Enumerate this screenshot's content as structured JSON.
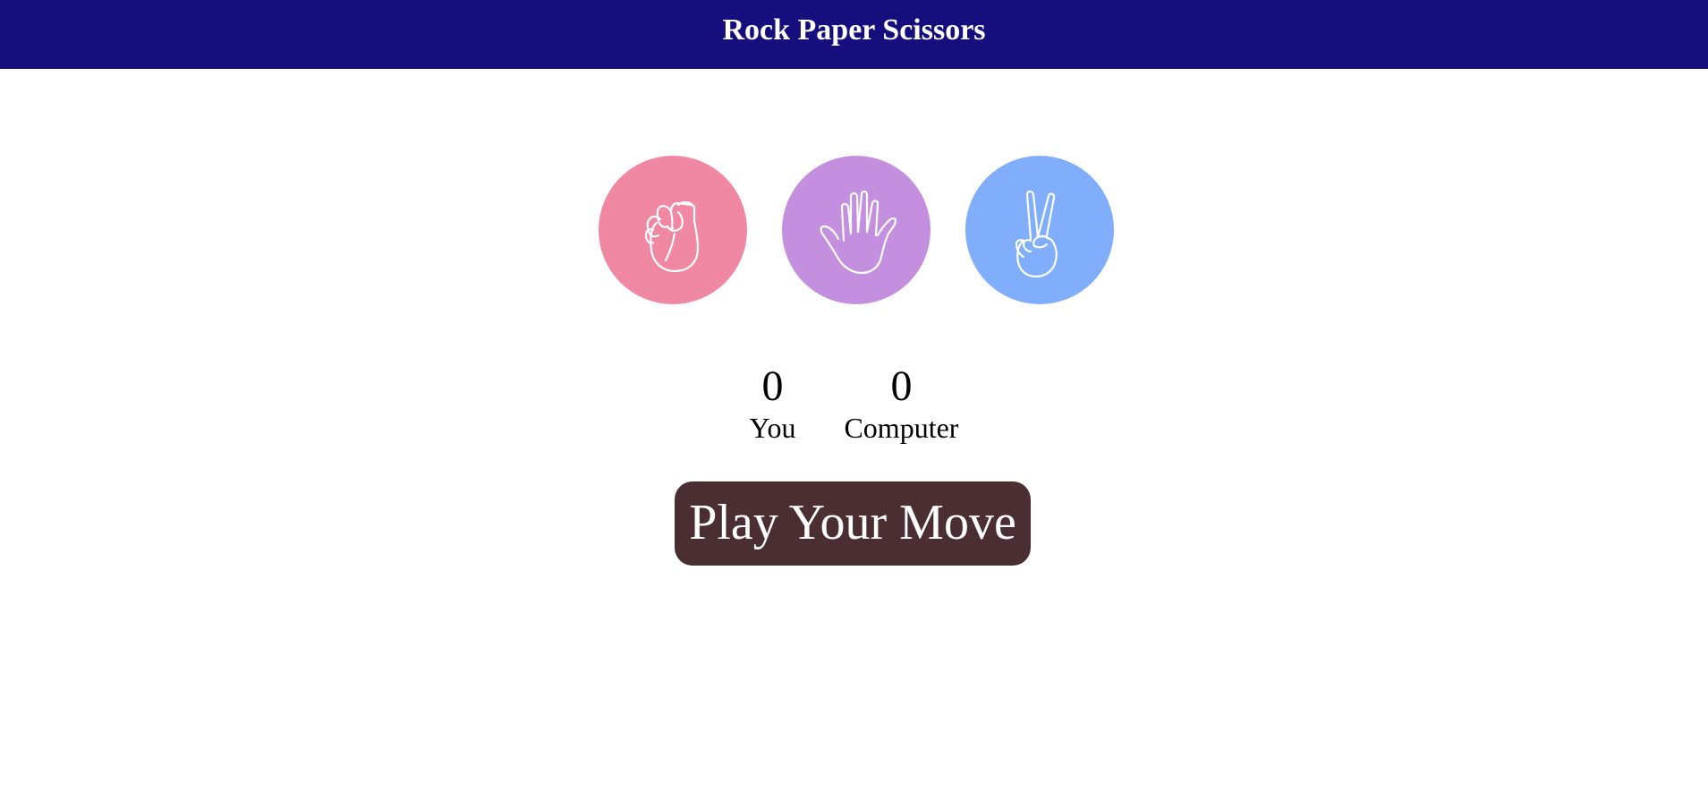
{
  "header": {
    "title": "Rock Paper Scissors"
  },
  "choices": [
    {
      "name": "rock",
      "icon": "fist-icon",
      "color": "#f088a4"
    },
    {
      "name": "paper",
      "icon": "open-hand-icon",
      "color": "#c38fde"
    },
    {
      "name": "scissors",
      "icon": "peace-hand-icon",
      "color": "#80aefb"
    }
  ],
  "scores": {
    "you": {
      "value": "0",
      "label": "You"
    },
    "computer": {
      "value": "0",
      "label": "Computer"
    }
  },
  "play_button": {
    "label": "Play Your Move",
    "color": "#4a2e31"
  },
  "colors": {
    "header_bg": "#170e7d"
  }
}
